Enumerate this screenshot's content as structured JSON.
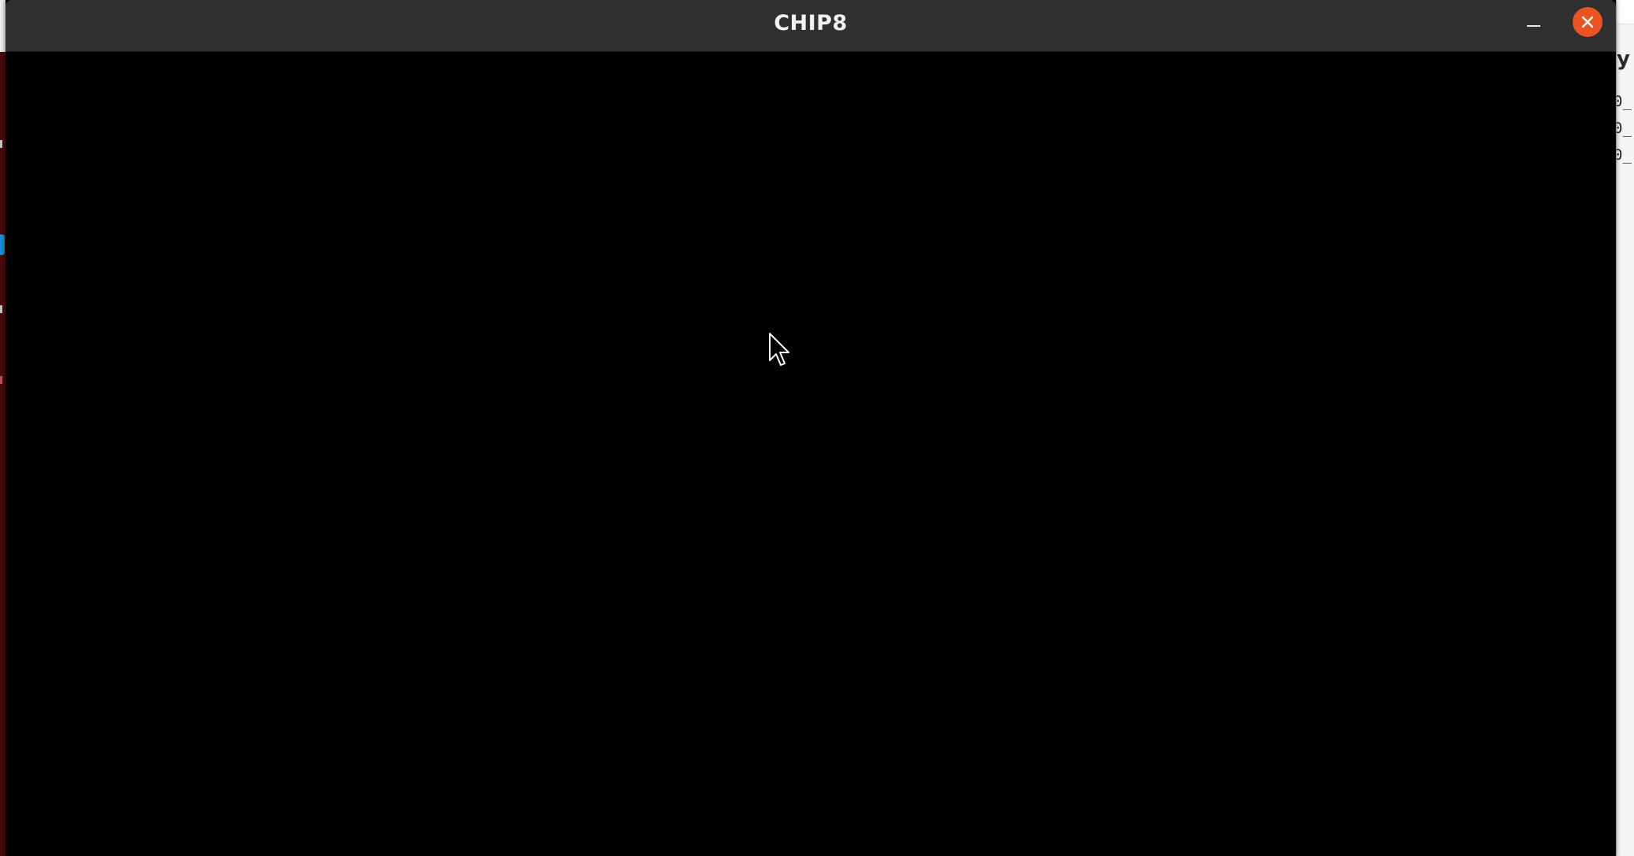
{
  "window": {
    "title": "CHIP8",
    "buttons": {
      "minimize": "minimize",
      "close": "close"
    },
    "accent_close": "#e95420",
    "titlebar_color": "#303030",
    "display_color": "#000000"
  },
  "background_right": {
    "fragments": [
      "y",
      "0_",
      "0_",
      "0_"
    ]
  },
  "icons": {
    "minimize": "minimize-icon",
    "close": "close-icon",
    "cursor": "mouse-pointer-icon"
  }
}
